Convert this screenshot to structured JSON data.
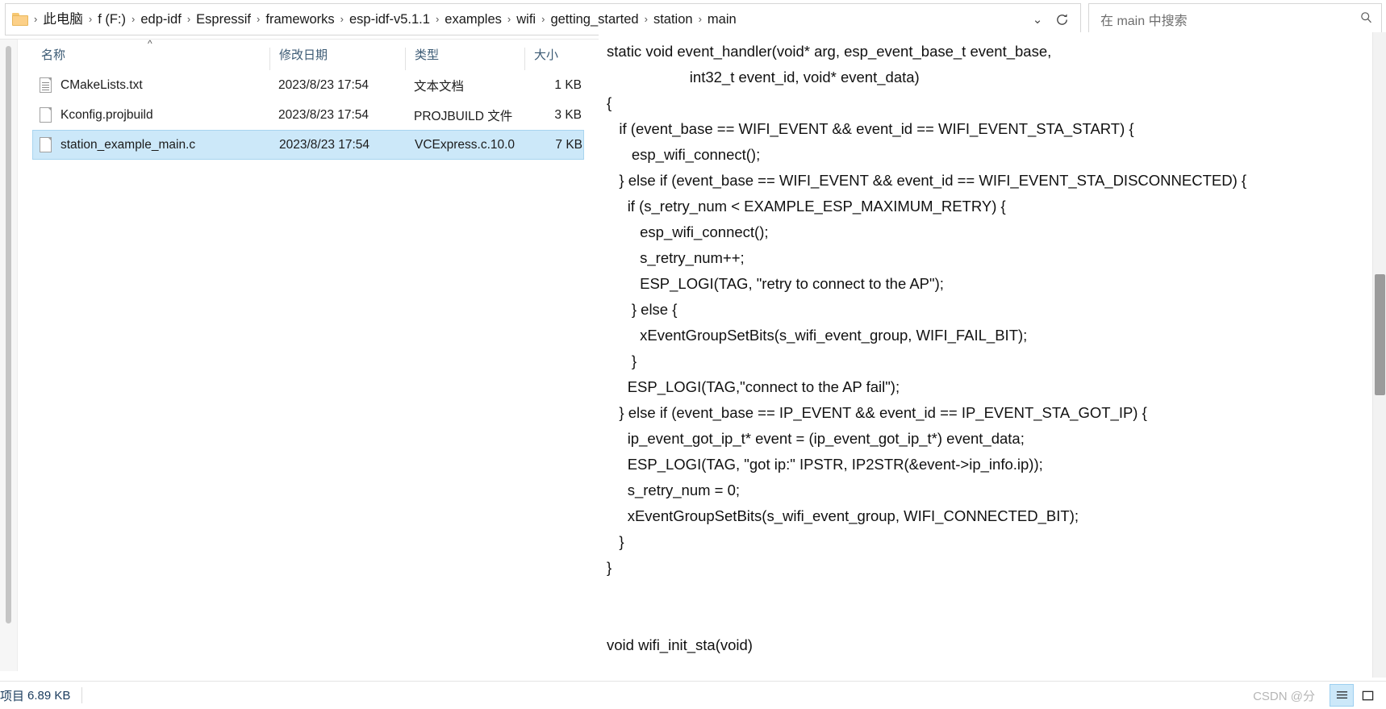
{
  "address_bar": {
    "folder_icon": "folder-icon",
    "crumbs": [
      "此电脑",
      "f (F:)",
      "edp-idf",
      "Espressif",
      "frameworks",
      "esp-idf-v5.1.1",
      "examples",
      "wifi",
      "getting_started",
      "station",
      "main"
    ],
    "separator": "›",
    "history_chevron": "⌄",
    "refresh_icon": "refresh-icon",
    "search": {
      "placeholder": "在 main 中搜索",
      "icon": "search-icon"
    }
  },
  "file_list": {
    "columns": [
      {
        "label": "名称",
        "key": "name"
      },
      {
        "label": "修改日期",
        "key": "date"
      },
      {
        "label": "类型",
        "key": "type"
      },
      {
        "label": "大小",
        "key": "size"
      }
    ],
    "sort_indicator": "^",
    "rows": [
      {
        "name": "CMakeLists.txt",
        "date": "2023/8/23 17:54",
        "type": "文本文档",
        "size": "1 KB",
        "icon": "text-document-icon",
        "selected": false
      },
      {
        "name": "Kconfig.projbuild",
        "date": "2023/8/23 17:54",
        "type": "PROJBUILD 文件",
        "size": "3 KB",
        "icon": "generic-file-icon",
        "selected": false
      },
      {
        "name": "station_example_main.c",
        "date": "2023/8/23 17:54",
        "type": "VCExpress.c.10.0",
        "size": "7 KB",
        "icon": "c-source-file-icon",
        "selected": true
      }
    ]
  },
  "preview": {
    "code_lines": [
      "static void event_handler(void* arg, esp_event_base_t event_base,",
      "                    int32_t event_id, void* event_data)",
      "{",
      "   if (event_base == WIFI_EVENT && event_id == WIFI_EVENT_STA_START) {",
      "      esp_wifi_connect();",
      "   } else if (event_base == WIFI_EVENT && event_id == WIFI_EVENT_STA_DISCONNECTED) {",
      "     if (s_retry_num < EXAMPLE_ESP_MAXIMUM_RETRY) {",
      "        esp_wifi_connect();",
      "        s_retry_num++;",
      "        ESP_LOGI(TAG, \"retry to connect to the AP\");",
      "      } else {",
      "        xEventGroupSetBits(s_wifi_event_group, WIFI_FAIL_BIT);",
      "      }",
      "     ESP_LOGI(TAG,\"connect to the AP fail\");",
      "   } else if (event_base == IP_EVENT && event_id == IP_EVENT_STA_GOT_IP) {",
      "     ip_event_got_ip_t* event = (ip_event_got_ip_t*) event_data;",
      "     ESP_LOGI(TAG, \"got ip:\" IPSTR, IP2STR(&event->ip_info.ip));",
      "     s_retry_num = 0;",
      "     xEventGroupSetBits(s_wifi_event_group, WIFI_CONNECTED_BIT);",
      "   }",
      "}",
      "",
      "",
      "void wifi_init_sta(void)"
    ]
  },
  "status_bar": {
    "item_count": "项目",
    "total_size": "6.89 KB",
    "view_details_icon": "details-view-icon",
    "view_tiles_icon": "large-icons-view-icon"
  },
  "watermark": {
    "text": "CSDN @分"
  },
  "colors": {
    "selection_bg": "#cce8f9",
    "selection_border": "#a8d4ef",
    "header_text": "#3b5a74",
    "status_text": "#1b3c5e",
    "folder_yellow": "#fcd088"
  }
}
